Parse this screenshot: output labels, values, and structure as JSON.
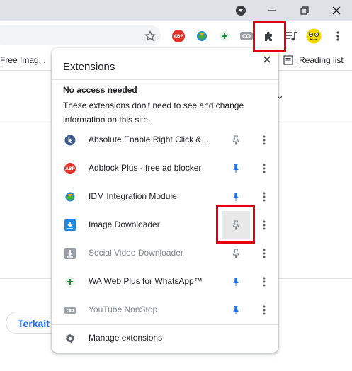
{
  "bookmarks": {
    "item1": "Free Imag...",
    "reading_list": "Reading list"
  },
  "page": {
    "terkait": "Terkait"
  },
  "popup": {
    "title": "Extensions",
    "section_title": "No access needed",
    "section_desc": "These extensions don't need to see and change information on this site.",
    "items": [
      {
        "name": "Absolute Enable Right Click &...",
        "pinned": false,
        "icon": "cursor-icon",
        "dim": false
      },
      {
        "name": "Adblock Plus - free ad blocker",
        "pinned": true,
        "icon": "abp-icon",
        "dim": false
      },
      {
        "name": "IDM Integration Module",
        "pinned": true,
        "icon": "idm-icon",
        "dim": false
      },
      {
        "name": "Image Downloader",
        "pinned": false,
        "icon": "download-icon",
        "dim": false
      },
      {
        "name": "Social Video Downloader",
        "pinned": false,
        "icon": "download-gray-icon",
        "dim": true
      },
      {
        "name": "WA Web Plus for WhatsApp™",
        "pinned": true,
        "icon": "plus-icon",
        "dim": false
      },
      {
        "name": "YouTube NonStop",
        "pinned": true,
        "icon": "infinity-icon",
        "dim": true
      }
    ],
    "manage": "Manage extensions"
  },
  "colors": {
    "highlight": "#e3000f",
    "pin_active": "#1a73e8",
    "pin_inactive": "#80868b",
    "abp": "#e4322b"
  }
}
